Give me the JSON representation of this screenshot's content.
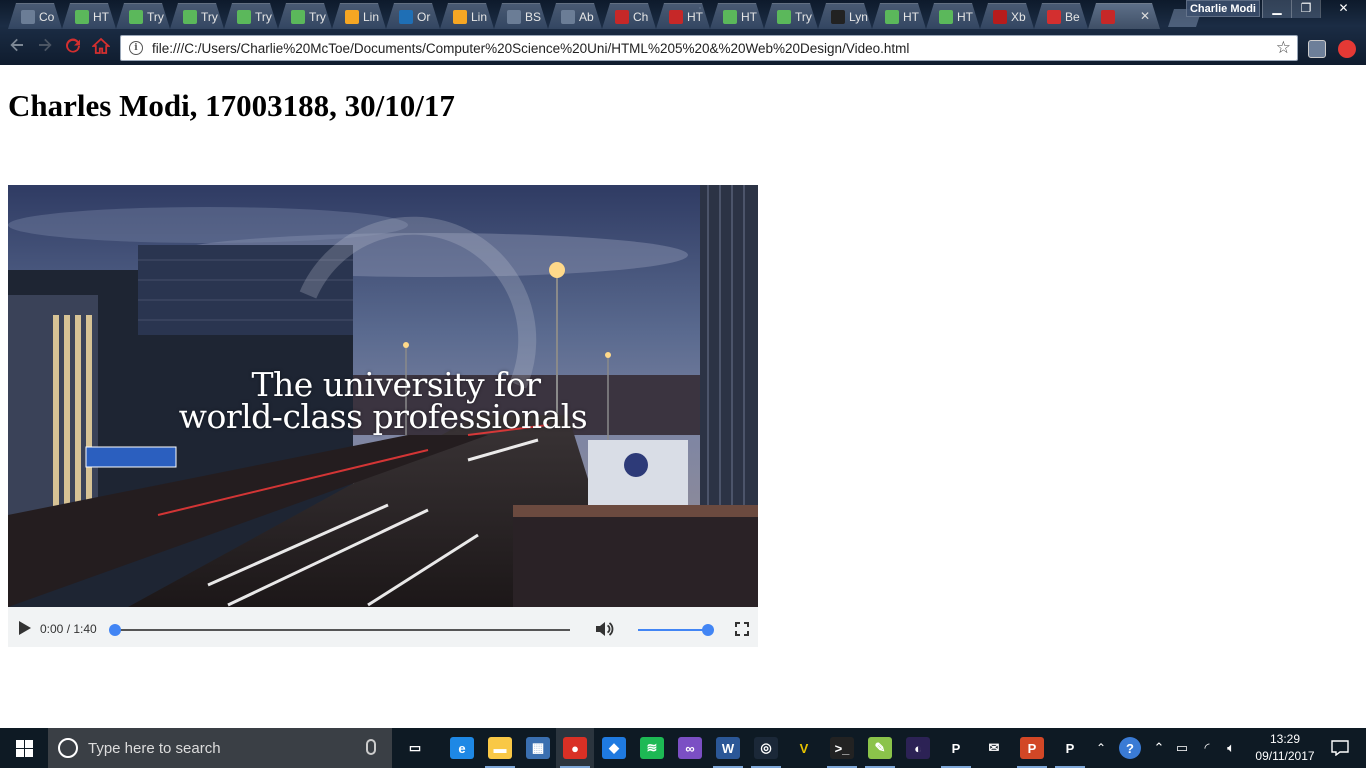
{
  "browser": {
    "tabs": [
      {
        "label": "Co",
        "icon": "settings-icon",
        "color": "#6b7d96"
      },
      {
        "label": "HT",
        "icon": "w3schools-icon",
        "color": "#5bb85b"
      },
      {
        "label": "Try",
        "icon": "w3schools-icon",
        "color": "#5bb85b"
      },
      {
        "label": "Try",
        "icon": "w3schools-icon",
        "color": "#5bb85b"
      },
      {
        "label": "Try",
        "icon": "w3schools-icon",
        "color": "#5bb85b"
      },
      {
        "label": "Try",
        "icon": "w3schools-icon",
        "color": "#5bb85b"
      },
      {
        "label": "Lin",
        "icon": "grid-icon",
        "color": "#f5a623"
      },
      {
        "label": "Or",
        "icon": "dollar-icon",
        "color": "#1f6fb5"
      },
      {
        "label": "Lin",
        "icon": "grid-icon",
        "color": "#f5a623"
      },
      {
        "label": "BS",
        "icon": "settings-icon",
        "color": "#6b7d96"
      },
      {
        "label": "Ab",
        "icon": "settings-icon",
        "color": "#6b7d96"
      },
      {
        "label": "Ch",
        "icon": "pdf-icon",
        "color": "#c62828"
      },
      {
        "label": "HT",
        "icon": "pdf-icon",
        "color": "#c62828"
      },
      {
        "label": "HT",
        "icon": "w3schools-icon",
        "color": "#5bb85b"
      },
      {
        "label": "Try",
        "icon": "w3schools-icon",
        "color": "#5bb85b"
      },
      {
        "label": "Lyn",
        "icon": "lynda-icon",
        "color": "#222222"
      },
      {
        "label": "HT",
        "icon": "w3schools-icon",
        "color": "#5bb85b"
      },
      {
        "label": "HT",
        "icon": "w3schools-icon",
        "color": "#5bb85b"
      },
      {
        "label": "Xb",
        "icon": "xbox-icon",
        "color": "#b71c1c"
      },
      {
        "label": "Be",
        "icon": "location-icon",
        "color": "#d32f2f"
      },
      {
        "label": "",
        "icon": "pdf-icon",
        "color": "#c62828",
        "active": true,
        "close": "✕"
      }
    ],
    "profile_name": "Charlie Modi",
    "window_buttons": {
      "minimize": "▁",
      "restore": "❐",
      "close": "✕"
    },
    "address_bar": {
      "url": "file:///C:/Users/Charlie%20McToe/Documents/Computer%20Science%20Uni/HTML%205%20&%20Web%20Design/Video.html",
      "info_icon": "i",
      "bookmark_icon": "☆"
    }
  },
  "page": {
    "title": "Charles Modi, 17003188, 30/10/17"
  },
  "video": {
    "overlay_line1": "The university for",
    "overlay_line2": "world-class professionals",
    "current_time": "0:00",
    "duration": "1:40",
    "time_display": "0:00 / 1:40",
    "progress_fraction": 0.0,
    "volume_fraction": 1.0,
    "accent_color": "#4285f4"
  },
  "taskbar": {
    "search_placeholder": "Type here to search",
    "apps": [
      {
        "name": "task-view",
        "glyph": "▭",
        "color": "transparent"
      },
      {
        "name": "edge",
        "glyph": "e",
        "color": "#1e88e5"
      },
      {
        "name": "file-explorer",
        "glyph": "▬",
        "color": "#f9c846"
      },
      {
        "name": "store",
        "glyph": "▦",
        "color": "#3a6fb0"
      },
      {
        "name": "chrome",
        "glyph": "●",
        "color": "#d93025"
      },
      {
        "name": "dropbox",
        "glyph": "◆",
        "color": "#1f7ae0"
      },
      {
        "name": "spotify",
        "glyph": "≋",
        "color": "#1db954"
      },
      {
        "name": "visual-studio",
        "glyph": "∞",
        "color": "#7b4fc4"
      },
      {
        "name": "word",
        "glyph": "W",
        "color": "#2b5797"
      },
      {
        "name": "steam",
        "glyph": "◎",
        "color": "#1b2838"
      },
      {
        "name": "vectorworks",
        "glyph": "V",
        "color": "transparent"
      },
      {
        "name": "command-prompt",
        "glyph": ">_",
        "color": "#222222"
      },
      {
        "name": "notepad-plus-plus",
        "glyph": "✎",
        "color": "#8bc34a"
      },
      {
        "name": "eclipse",
        "glyph": "◐",
        "color": "#2c2255"
      },
      {
        "name": "processing",
        "glyph": "P",
        "color": "transparent"
      },
      {
        "name": "mail",
        "glyph": "✉",
        "color": "transparent"
      },
      {
        "name": "powerpoint",
        "glyph": "P",
        "color": "#d24726"
      },
      {
        "name": "processing-2",
        "glyph": "P",
        "color": "transparent"
      }
    ],
    "clock_time": "13:29",
    "clock_date": "09/11/2017"
  }
}
